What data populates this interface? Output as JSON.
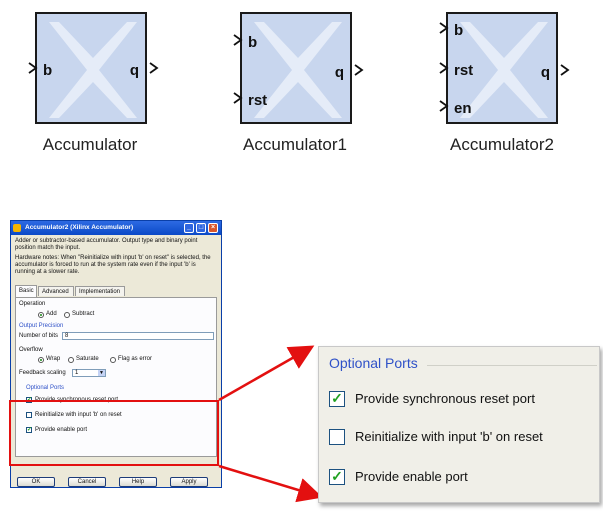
{
  "blocks": [
    {
      "label": "Accumulator",
      "inputs": [
        "b"
      ],
      "output": "q"
    },
    {
      "label": "Accumulator1",
      "inputs": [
        "b",
        "rst"
      ],
      "output": "q"
    },
    {
      "label": "Accumulator2",
      "inputs": [
        "b",
        "rst",
        "en"
      ],
      "output": "q"
    }
  ],
  "dialog": {
    "title": "Accumulator2 (Xilinx Accumulator)",
    "desc1": "Adder or subtractor-based accumulator. Output type and binary point position match the input.",
    "desc2": "Hardware notes: When \"Reinitialize with input 'b' on reset\" is selected, the accumulator is forced to run at the system rate even if the input 'b' is running at a slower rate.",
    "tabs": [
      "Basic",
      "Advanced",
      "Implementation"
    ],
    "operation_label": "Operation",
    "op_add": "Add",
    "op_subtract": "Subtract",
    "output_precision_label": "Output Precision",
    "num_bits_label": "Number of bits",
    "num_bits_value": "8",
    "overflow_label": "Overflow",
    "ov_wrap": "Wrap",
    "ov_saturate": "Saturate",
    "ov_flag": "Flag as error",
    "feedback_label": "Feedback scaling",
    "feedback_value": "1",
    "optional_ports_label": "Optional Ports",
    "opt_sync_reset": "Provide synchronous reset port",
    "opt_reinit": "Reinitialize with input 'b' on reset",
    "opt_enable": "Provide enable port",
    "btn_ok": "OK",
    "btn_cancel": "Cancel",
    "btn_help": "Help",
    "btn_apply": "Apply"
  },
  "zoom": {
    "title": "Optional Ports",
    "items": [
      {
        "label": "Provide synchronous reset port",
        "checked": true
      },
      {
        "label": "Reinitialize with input 'b' on reset",
        "checked": false
      },
      {
        "label": "Provide enable port",
        "checked": true
      }
    ]
  },
  "colors": {
    "block_fill": "#c8d6ee",
    "highlight": "#e31010",
    "group_title": "#2f51c8"
  }
}
